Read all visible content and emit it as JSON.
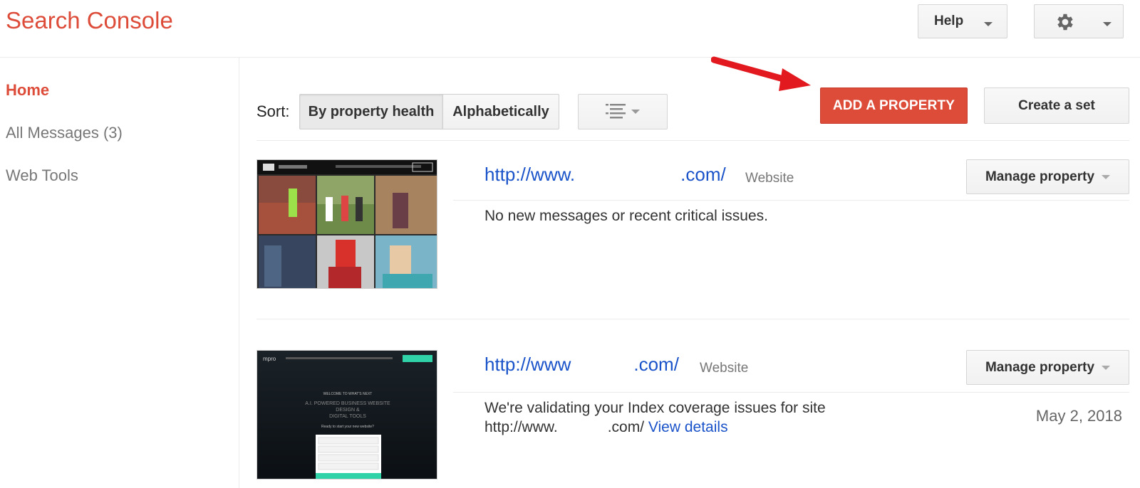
{
  "app": {
    "title": "Search Console"
  },
  "header": {
    "help_label": "Help"
  },
  "sidebar": {
    "items": [
      {
        "label": "Home"
      },
      {
        "label": "All Messages (3)"
      },
      {
        "label": "Web Tools"
      }
    ]
  },
  "toolbar": {
    "sort_label": "Sort:",
    "sort_options": [
      "By property health",
      "Alphabetically"
    ],
    "add_property_label": "ADD A PROPERTY",
    "create_set_label": "Create a set"
  },
  "properties": [
    {
      "url_prefix": "http://www.",
      "url_suffix": ".com/",
      "type": "Website",
      "manage_label": "Manage property",
      "message": "No new messages or recent critical issues."
    },
    {
      "url_prefix": "http://www",
      "url_suffix": ".com/",
      "type": "Website",
      "manage_label": "Manage property",
      "message_line1": "We're validating your Index coverage issues for site",
      "message_url_prefix": "http://www.",
      "message_url_suffix": ".com/",
      "message_link": "View details",
      "date": "May 2, 2018"
    }
  ],
  "thumb2_text": {
    "logo": "mpro",
    "welcome": "WELCOME TO WHAT'S NEXT",
    "headline1": "A.I. POWERED BUSINESS WEBSITE",
    "headline2": "DESIGN &",
    "headline3": "DIGITAL TOOLS",
    "sub": "Ready to start your new website?"
  },
  "colors": {
    "brand_red": "#dd4b39",
    "link_blue": "#1a53c9",
    "arrow_red": "#e2191f"
  },
  "icons": {
    "settings": "gear-icon",
    "list_view": "list-icon",
    "dropdown": "caret-down-icon"
  }
}
